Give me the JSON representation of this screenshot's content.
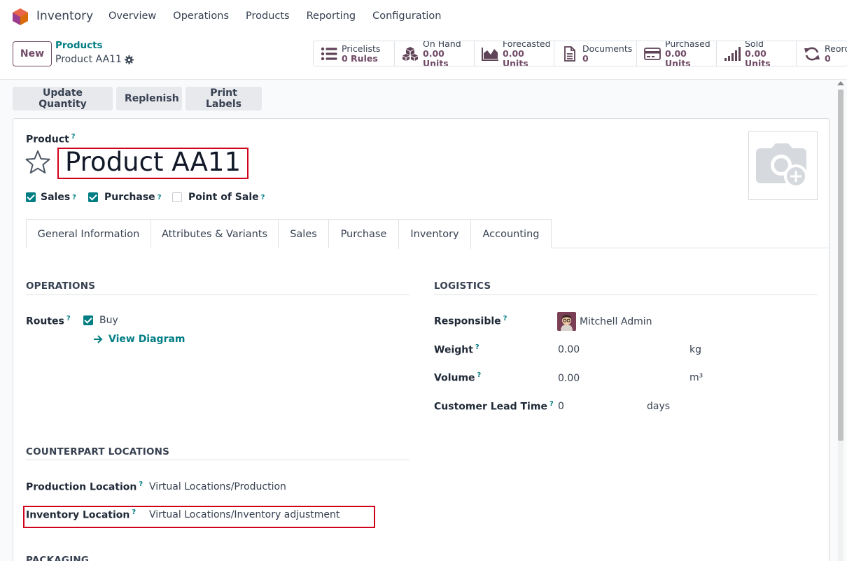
{
  "app": {
    "name": "Inventory"
  },
  "menu": [
    "Overview",
    "Operations",
    "Products",
    "Reporting",
    "Configuration"
  ],
  "control": {
    "new_label": "New",
    "breadcrumb_parent": "Products",
    "breadcrumb_current": "Product AA11"
  },
  "smart_buttons": [
    {
      "label": "Pricelists",
      "value": "0 Rules",
      "icon": "list-icon"
    },
    {
      "label": "On Hand",
      "value": "0.00 Units",
      "icon": "cubes-icon"
    },
    {
      "label": "Forecasted",
      "value": "0.00 Units",
      "icon": "area-chart-icon"
    },
    {
      "label": "Documents",
      "value": "0",
      "icon": "document-icon"
    },
    {
      "label": "Purchased",
      "value": "0.00 Units",
      "icon": "credit-card-icon"
    },
    {
      "label": "Sold",
      "value": "0.00 Units",
      "icon": "signal-icon"
    },
    {
      "label": "Reord",
      "value": "0",
      "icon": "refresh-icon"
    }
  ],
  "actions": [
    "Update Quantity",
    "Replenish",
    "Print Labels"
  ],
  "form": {
    "product_label": "Product",
    "product_name": "Product AA11",
    "checks": [
      {
        "label": "Sales",
        "checked": true
      },
      {
        "label": "Purchase",
        "checked": true
      },
      {
        "label": "Point of Sale",
        "checked": false
      }
    ],
    "tabs": [
      "General Information",
      "Attributes & Variants",
      "Sales",
      "Purchase",
      "Inventory",
      "Accounting"
    ],
    "active_tab": "Inventory",
    "operations": {
      "title": "OPERATIONS",
      "routes_label": "Routes",
      "route_buy": "Buy",
      "view_diagram": "View Diagram"
    },
    "logistics": {
      "title": "LOGISTICS",
      "responsible_label": "Responsible",
      "responsible_value": "Mitchell Admin",
      "weight_label": "Weight",
      "weight_value": "0.00",
      "weight_unit": "kg",
      "volume_label": "Volume",
      "volume_value": "0.00",
      "volume_unit": "m³",
      "lead_label": "Customer Lead Time",
      "lead_value": "0",
      "lead_unit": "days"
    },
    "counterpart": {
      "title": "COUNTERPART LOCATIONS",
      "production_label": "Production Location",
      "production_value": "Virtual Locations/Production",
      "inventory_label": "Inventory Location",
      "inventory_value": "Virtual Locations/Inventory adjustment"
    },
    "packaging_title": "PACKAGING"
  },
  "colors": {
    "brand": "#714b67",
    "accent": "#017e84",
    "highlight": "#d0021b"
  }
}
